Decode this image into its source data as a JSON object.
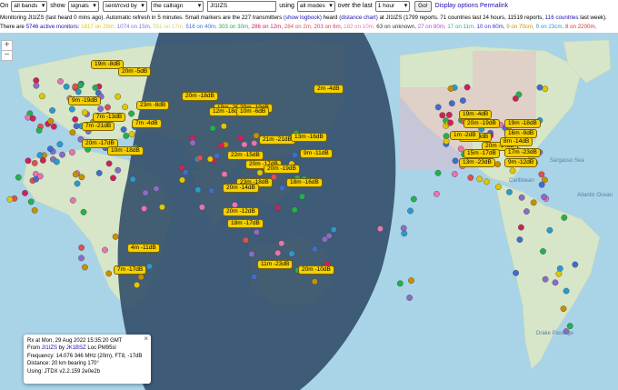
{
  "controls": {
    "on_label": "On",
    "bands_value": "all bands",
    "show_label": "show",
    "show_value": "signals",
    "sentrcvd_value": "sent/rcvd by",
    "callsign_field_value": "the callsign",
    "callsign_input": "JI1IZS",
    "using_label": "using",
    "modes_value": "all modes",
    "overlast_label": "over the last",
    "period_value": "1 hour",
    "go_button": "Go!",
    "display_options": "Display options",
    "permalink": "Permalink"
  },
  "info": {
    "line1_a": "Monitoring JI1IZS (last heard 0 mins ago). Automatic refresh in 5 minutes. Small markers are the 227 transmitters",
    "show_logbook": "(show logbook)",
    "heard": "heard",
    "distance_chart": "(distance chart)",
    "line1_b": "at JI1IZS (1799 reports. 71 countries last 24 hours, 11519 reports,",
    "countries": "116 countries",
    "line1_c": "last week).",
    "line2_a": "There are",
    "active_monitors": "5746 active monitors",
    "line2_b": ":",
    "bands": [
      {
        "text": "1817 on 20m,",
        "color": "#e0c800"
      },
      {
        "text": "1074 on 15m,",
        "color": "#8a6cc8"
      },
      {
        "text": "551 on 17m,",
        "color": "#d8d060"
      },
      {
        "text": "516 on 40m,",
        "color": "#3d6ecf"
      },
      {
        "text": "303 on 30m,",
        "color": "#22b24c"
      },
      {
        "text": "286 on 12m,",
        "color": "#d0205a"
      },
      {
        "text": "284 on 2m,",
        "color": "#e05050"
      },
      {
        "text": "203 on 6m,",
        "color": "#e0365a"
      },
      {
        "text": "182 on 10m,",
        "color": "#e874b0"
      },
      {
        "text": "63 on unknown,",
        "color": "#333333"
      },
      {
        "text": "27 on 80m,",
        "color": "#b34acf"
      },
      {
        "text": "17 on 11m,",
        "color": "#33a89a"
      },
      {
        "text": "10 on 60m,",
        "color": "#3333cc"
      },
      {
        "text": "9 on 70cm,",
        "color": "#c89000"
      },
      {
        "text": "9 on 23cm,",
        "color": "#2a9ad0"
      },
      {
        "text": "8 on 2200m,",
        "color": "#e03030"
      }
    ]
  },
  "map": {
    "zoom_in": "+",
    "zoom_out": "−",
    "ocean_color": "#a9d4e8",
    "land_color": "#d7e6c8",
    "night_color": "#2f4a66",
    "place_labels": [
      "Sargasso Sea",
      "Atlantic Ocean",
      "Drake Passage",
      "Caribbean"
    ],
    "signal_labels": [
      "2m -4dB",
      "19m -8dB",
      "20m -5dB",
      "20m -18dB",
      "23m -8dB",
      "9m -19dB",
      "7m -13dB",
      "7m -4dB",
      "7m -21dB",
      "20m -17dB",
      "10m -18dB",
      "19m -20dB",
      "20m -19dB",
      "12m -18dB",
      "10m -6dB",
      "21m -21dB",
      "13m -16dB",
      "9m -11dB",
      "20m -17dB",
      "20m -19dB",
      "22m -15dB",
      "18m -16dB",
      "23m -18dB",
      "4m -11dB",
      "7m -17dB",
      "11m -23dB",
      "20m -10dB",
      "20m -14dB",
      "20m -12dB",
      "18m -17dB",
      "19m -4dB",
      "20m -19dB",
      "5m -18dB",
      "20m -14dB",
      "15m -17dB",
      "17m -23dB",
      "19m -18dB",
      "16m -9dB",
      "8m -14dB",
      "9m -12dB",
      "1m -2dB",
      "13m -23dB"
    ]
  },
  "popup": {
    "close": "×",
    "line1": "Rx at Mon, 29 Aug 2022 15:35:20 GMT",
    "from_label": "From",
    "from_call": "JI1IZS",
    "by_label": "by",
    "by_call": "JK1BSZ",
    "loc": "Loc PM95sl",
    "line3": "Frequency: 14.076 346 MHz (20m), FT8, -17dB",
    "line4": "Distance: 20 km bearing 170°",
    "line5": "Using: JTDX v2.2.159 2e0e2b"
  }
}
